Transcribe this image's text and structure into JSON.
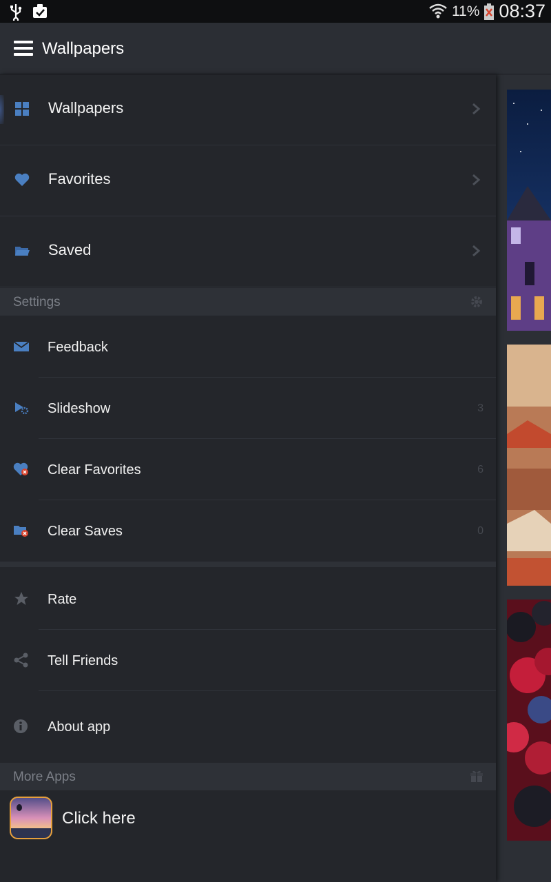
{
  "status_bar": {
    "battery_percent": "11%",
    "time": "08:37"
  },
  "app_bar": {
    "title": "Wallpapers"
  },
  "nav": [
    {
      "label": "Wallpapers",
      "icon": "grid-icon"
    },
    {
      "label": "Favorites",
      "icon": "heart-icon"
    },
    {
      "label": "Saved",
      "icon": "folder-icon"
    }
  ],
  "settings": {
    "header": "Settings",
    "items": [
      {
        "label": "Feedback",
        "icon": "envelope-icon",
        "count": ""
      },
      {
        "label": "Slideshow",
        "icon": "slideshow-icon",
        "count": "3"
      },
      {
        "label": "Clear Favorites",
        "icon": "heart-remove-icon",
        "count": "6"
      },
      {
        "label": "Clear Saves",
        "icon": "folder-remove-icon",
        "count": "0"
      }
    ]
  },
  "extras": [
    {
      "label": "Rate",
      "icon": "star-icon"
    },
    {
      "label": "Tell Friends",
      "icon": "share-icon"
    },
    {
      "label": "About app",
      "icon": "info-icon"
    }
  ],
  "more_apps": {
    "header": "More Apps",
    "promo_label": "Click here"
  },
  "colors": {
    "accent": "#4a7fc1",
    "background": "#24262b",
    "section_header": "#2e3137"
  }
}
